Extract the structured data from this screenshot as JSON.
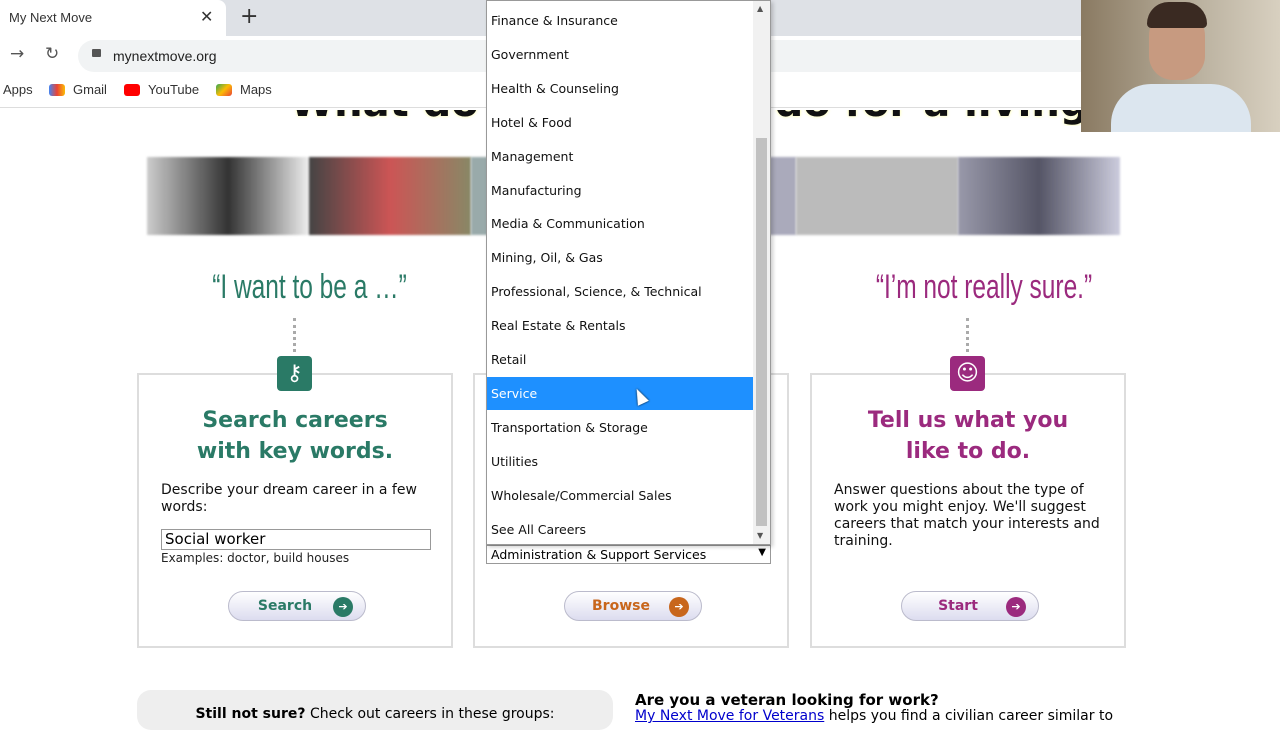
{
  "browser": {
    "tab_title": "My Next Move",
    "url": "mynextmove.org",
    "bookmarks": [
      {
        "label": "Apps",
        "icon": "apps-icon"
      },
      {
        "label": "Gmail",
        "icon": "gmail-icon"
      },
      {
        "label": "YouTube",
        "icon": "youtube-icon"
      },
      {
        "label": "Maps",
        "icon": "maps-icon"
      }
    ]
  },
  "hero": {
    "title": "What do you want to do for a living?"
  },
  "cards": {
    "search": {
      "quote": "“I want to be a …”",
      "heading_1": "Search careers",
      "heading_2": "with key words.",
      "prompt": "Describe your dream career in a few words:",
      "input_value": "Social worker",
      "examples": "Examples: doctor, build houses",
      "button": "Search",
      "color": "#2a7a66"
    },
    "browse": {
      "selected": "Administration & Support Services",
      "button": "Browse",
      "color": "#c8661c"
    },
    "explore": {
      "quote": "“I’m not really sure.”",
      "heading_1": "Tell us what you",
      "heading_2": "like to do.",
      "text": "Answer questions about the type of work you might enjoy. We'll suggest careers that match your interests and training.",
      "button": "Start",
      "color": "#9b2a7e"
    }
  },
  "dropdown": {
    "highlighted": "Service",
    "options": [
      "Finance & Insurance",
      "Government",
      "Health & Counseling",
      "Hotel & Food",
      "Management",
      "Manufacturing",
      "Media & Communication",
      "Mining, Oil, & Gas",
      "Professional, Science, & Technical",
      "Real Estate & Rentals",
      "Retail",
      "Service",
      "Transportation & Storage",
      "Utilities",
      "Wholesale/Commercial Sales",
      "See All Careers"
    ]
  },
  "footer": {
    "still_bold": "Still not sure?",
    "still_rest": " Check out careers in these groups:",
    "vet_heading": "Are you a veteran looking for work?",
    "vet_link": "My Next Move for Veterans",
    "vet_rest": " helps you find a civilian career similar to"
  }
}
